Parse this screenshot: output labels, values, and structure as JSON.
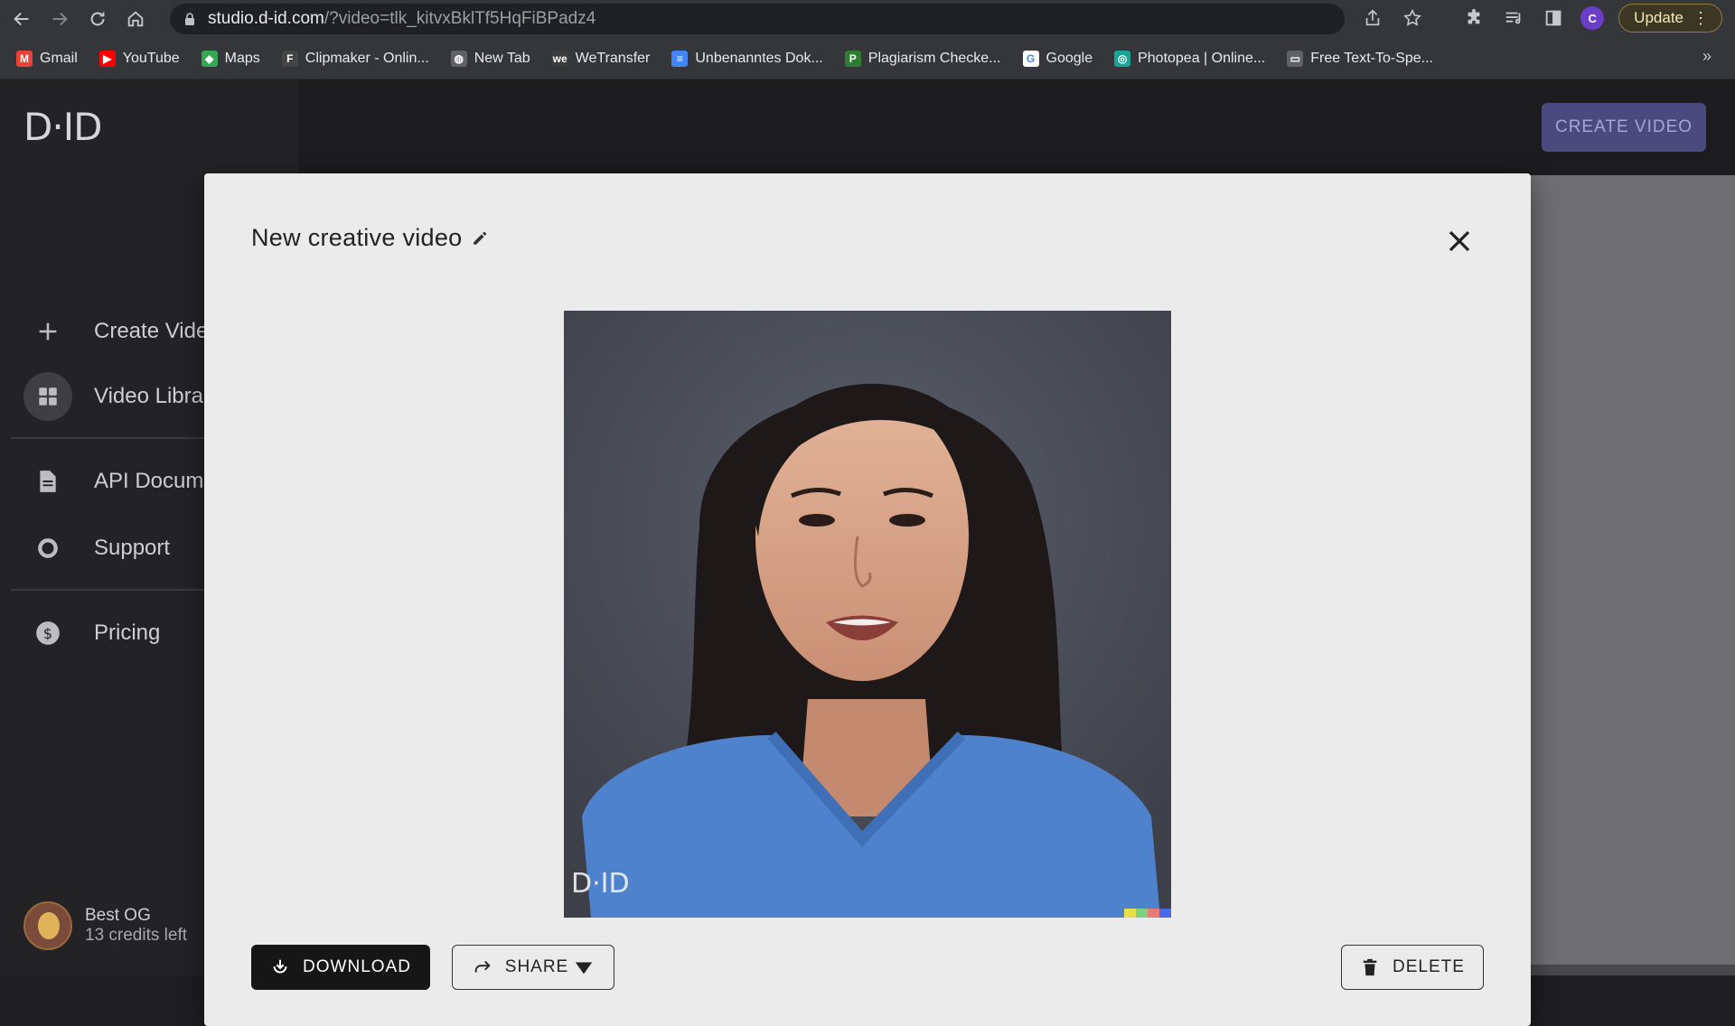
{
  "browser": {
    "url_host": "studio.d-id.com",
    "url_path": "/?video=tlk_kitvxBklTf5HqFiBPadz4",
    "profile_initial": "C",
    "update_label": "Update"
  },
  "bookmarks": [
    {
      "label": "Gmail",
      "icon": "gmail-icon",
      "color": "#ea4335",
      "glyph": "M"
    },
    {
      "label": "YouTube",
      "icon": "youtube-icon",
      "color": "#ff0000",
      "glyph": "▶"
    },
    {
      "label": "Maps",
      "icon": "maps-icon",
      "color": "#34a853",
      "glyph": "◆"
    },
    {
      "label": "Clipmaker - Onlin...",
      "icon": "clipmaker-icon",
      "color": "#444444",
      "glyph": "F"
    },
    {
      "label": "New Tab",
      "icon": "globe-icon",
      "color": "#5f6368",
      "glyph": "◍"
    },
    {
      "label": "WeTransfer",
      "icon": "wetransfer-icon",
      "color": "#3c3c3c",
      "glyph": "we"
    },
    {
      "label": "Unbenanntes Dok...",
      "icon": "docs-icon",
      "color": "#4285f4",
      "glyph": "≡"
    },
    {
      "label": "Plagiarism Checke...",
      "icon": "plagiarism-icon",
      "color": "#2e7d32",
      "glyph": "P"
    },
    {
      "label": "Google",
      "icon": "google-icon",
      "color": "#ffffff",
      "glyph": "G"
    },
    {
      "label": "Photopea | Online...",
      "icon": "photopea-icon",
      "color": "#18a497",
      "glyph": "◎"
    },
    {
      "label": "Free Text-To-Spe...",
      "icon": "page-icon",
      "color": "#5f6368",
      "glyph": "▭"
    }
  ],
  "sidebar": {
    "logo": "D·ID",
    "items": [
      {
        "label": "Create Video",
        "icon": "plus-icon"
      },
      {
        "label": "Video Library",
        "icon": "grid-icon"
      },
      {
        "label": "API Documentation",
        "icon": "document-icon"
      },
      {
        "label": "Support",
        "icon": "lifebuoy-icon"
      },
      {
        "label": "Pricing",
        "icon": "dollar-icon"
      }
    ],
    "user": {
      "name": "Best OG",
      "credits": "13 credits left"
    }
  },
  "header": {
    "create_video_label": "CREATE VIDEO",
    "accent": "#4b4a7e"
  },
  "modal": {
    "title": "New creative video",
    "video_watermark": "D·ID",
    "download_label": "DOWNLOAD",
    "share_label": "SHARE",
    "delete_label": "DELETE"
  }
}
